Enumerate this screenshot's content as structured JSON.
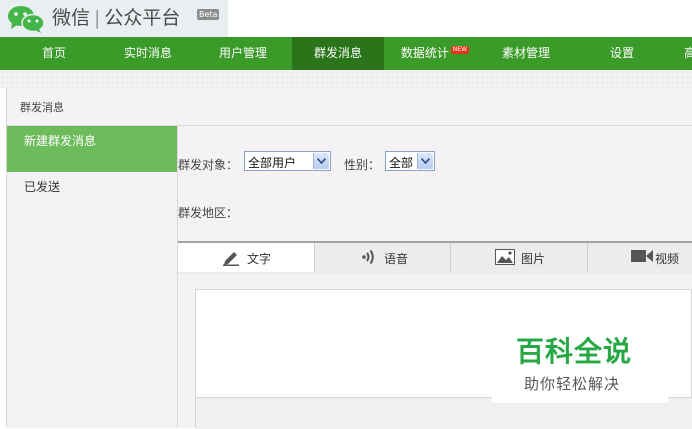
{
  "header": {
    "logo_name": "微信",
    "logo_separator": "|",
    "logo_product": "公众平台",
    "beta_tag": "Beta"
  },
  "nav": {
    "items": [
      {
        "label": "首页"
      },
      {
        "label": "实时消息"
      },
      {
        "label": "用户管理"
      },
      {
        "label": "群发消息",
        "active": true
      },
      {
        "label": "数据统计",
        "badge": "NEW"
      },
      {
        "label": "素材管理"
      },
      {
        "label": "设置"
      },
      {
        "label": "高"
      }
    ]
  },
  "breadcrumb": "群发消息",
  "sidebar": {
    "items": [
      {
        "label": "新建群发消息",
        "active": true
      },
      {
        "label": "已发送"
      }
    ]
  },
  "form": {
    "target_label": "群发对象：",
    "target_value": "全部用户",
    "gender_label": "性别：",
    "gender_value": "全部",
    "region_label": "群发地区："
  },
  "tabs": [
    {
      "label": "文字",
      "icon": "pencil-icon",
      "active": true
    },
    {
      "label": "语音",
      "icon": "sound-icon"
    },
    {
      "label": "图片",
      "icon": "image-icon"
    },
    {
      "label": "视频",
      "icon": "video-icon"
    }
  ],
  "watermark": {
    "main": "百科全说",
    "sub": "助你轻松解决"
  },
  "colors": {
    "nav_green": "#3a9b28",
    "nav_active": "#2a7419",
    "sidebar_active": "#6dbb5b",
    "watermark_green": "#27a845"
  }
}
